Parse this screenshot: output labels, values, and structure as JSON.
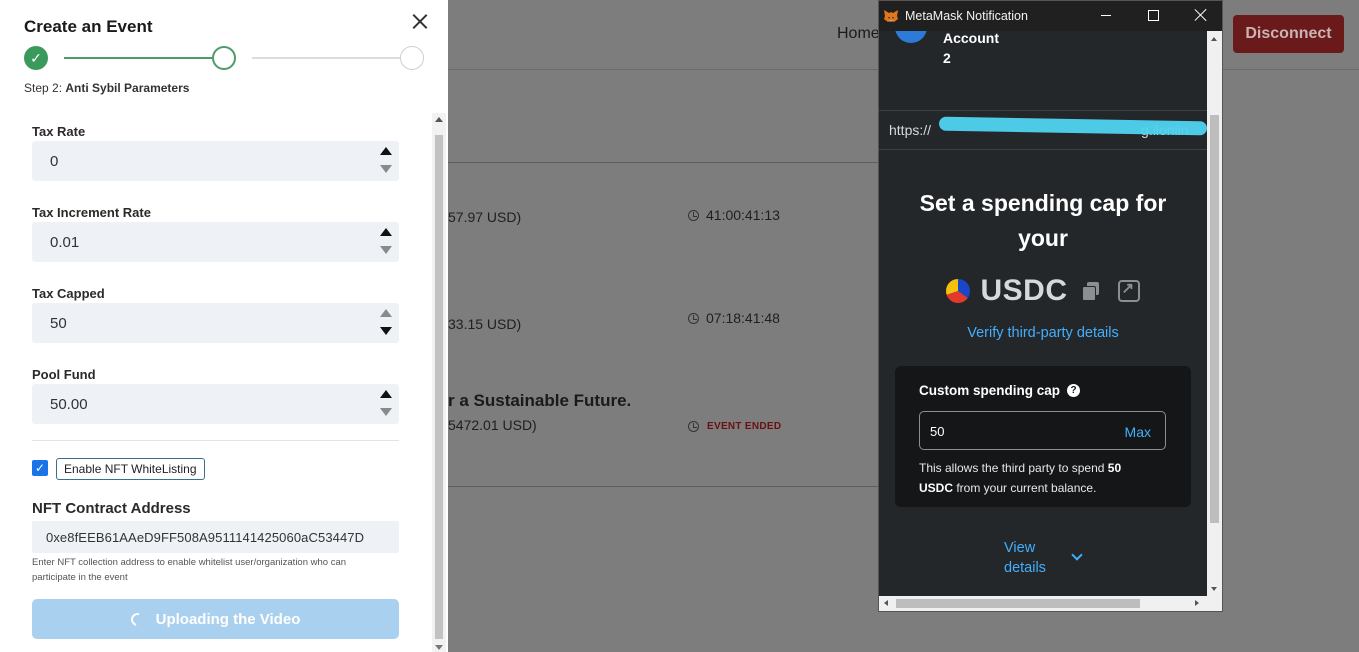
{
  "background": {
    "nav_home": "Home",
    "disconnect_label": "Disconnect",
    "rows": [
      {
        "amount": "57.97 USD)",
        "timer": "41:00:41:13"
      },
      {
        "amount": "33.15 USD)",
        "timer": "07:18:41:48"
      },
      {
        "title": "r a Sustainable Future.",
        "amount": "5472.01 USD)",
        "status": "EVENT ENDED"
      }
    ]
  },
  "modal": {
    "title": "Create an Event",
    "step_prefix": "Step 2:",
    "step_name": "Anti Sybil Parameters",
    "step_done_check": "✓",
    "fields": [
      {
        "label": "Tax Rate",
        "value": "0"
      },
      {
        "label": "Tax Increment Rate",
        "value": "0.01"
      },
      {
        "label": "Tax Capped",
        "value": "50"
      },
      {
        "label": "Pool Fund",
        "value": "50.00"
      }
    ],
    "checkbox_mark": "✓",
    "whitelist_label": "Enable NFT WhiteListing",
    "nft_title": "NFT Contract Address",
    "nft_value": "0xe8fEEB61AAeD9FF508A9511141425060aC53447D",
    "nft_help": "Enter NFT collection address to enable whitelist user/organization who can participate in the event",
    "upload_label": "Uploading the Video"
  },
  "metamask": {
    "window_title": "MetaMask Notification",
    "account_line1": "Account",
    "account_line2": "2",
    "url": "https://",
    "url_tail": "g.ilonlin",
    "heading": "Set a spending cap for your",
    "token": "USDC",
    "verify": "Verify third-party details",
    "cap_title": "Custom spending cap",
    "cap_q": "?",
    "cap_value": "50",
    "max_label": "Max",
    "allow_pre": "This allows the third party to spend ",
    "allow_amount": "50",
    "allow_token": "USDC",
    "allow_post": " from your current balance.",
    "view_details_1": "View",
    "view_details_2": "details"
  },
  "colors": {
    "accent_green": "#3a9a5b",
    "metamask_blue": "#43aefc",
    "disconnect_red": "#6a1a1a",
    "upload_button": "#a9d0ef"
  }
}
